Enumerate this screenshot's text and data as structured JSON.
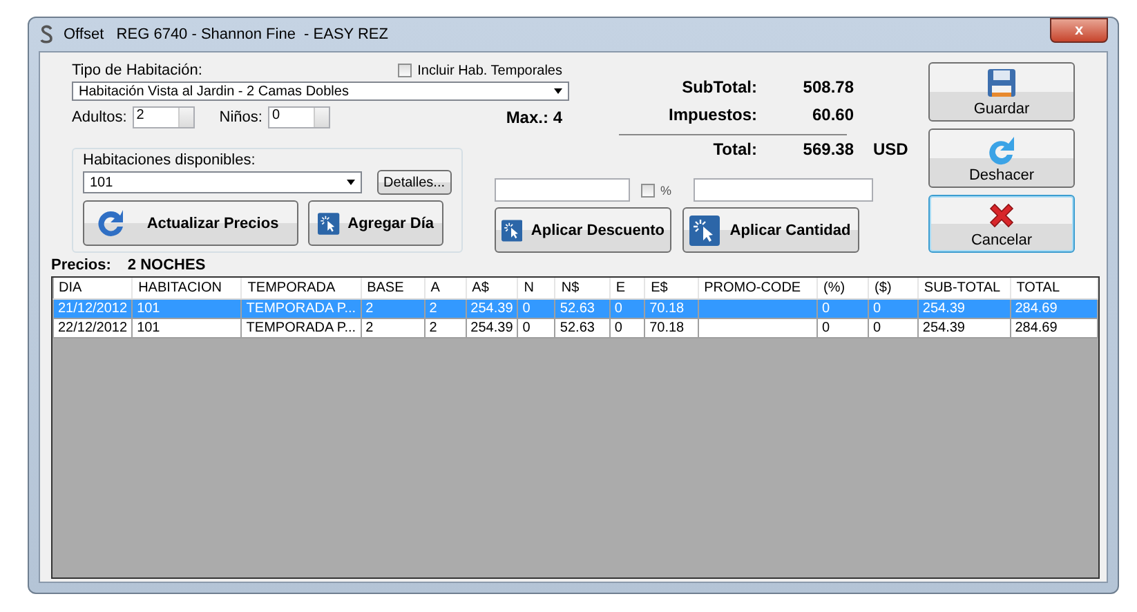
{
  "window": {
    "title": "Offset   REG 6740 - Shannon Fine  - EASY REZ",
    "close_label": "x"
  },
  "room_type": {
    "label": "Tipo de Habitación:",
    "value": "Habitación Vista al Jardin - 2 Camas Dobles"
  },
  "include_temporary": {
    "label": "Incluir Hab. Temporales",
    "checked": false
  },
  "adults": {
    "label": "Adultos:",
    "value": "2"
  },
  "children": {
    "label": "Niños:",
    "value": "0"
  },
  "max": "Max.: 4",
  "available": {
    "label": "Habitaciones disponibles:",
    "value": "101",
    "details_button": "Detalles..."
  },
  "action_buttons": [
    {
      "label": "Actualizar Precios",
      "kind": "refresh"
    },
    {
      "label": "Agregar Día",
      "kind": "click"
    }
  ],
  "discount": {
    "percent_label": "%",
    "percent_checked": false,
    "buttons": [
      {
        "label": "Aplicar Descuento",
        "kind": "click"
      },
      {
        "label": "Aplicar Cantidad",
        "kind": "click"
      }
    ]
  },
  "totals": [
    {
      "label": "SubTotal:",
      "value": "508.78"
    },
    {
      "label": "Impuestos:",
      "value": "60.60"
    },
    {
      "label": "Total:",
      "value": "569.38",
      "currency": "USD"
    }
  ],
  "side_buttons": [
    {
      "label": "Guardar",
      "kind": "save",
      "focused": false
    },
    {
      "label": "Deshacer",
      "kind": "undo",
      "focused": false
    },
    {
      "label": "Cancelar",
      "kind": "cancel",
      "focused": true
    }
  ],
  "prices": {
    "label": "Precios:",
    "nights": "2 NOCHES"
  },
  "table": {
    "columns": [
      "DIA",
      "HABITACION",
      "TEMPORADA",
      "BASE",
      "A",
      "A$",
      "N",
      "N$",
      "E",
      "E$",
      "PROMO-CODE",
      "(%)",
      "($)",
      "SUB-TOTAL",
      "TOTAL"
    ],
    "rows": [
      {
        "selected": true,
        "cells": [
          "21/12/2012",
          "101",
          "TEMPORADA P...",
          "2",
          "2",
          "254.39",
          "0",
          "52.63",
          "0",
          "70.18",
          "",
          "0",
          "0",
          "254.39",
          "284.69"
        ]
      },
      {
        "selected": false,
        "cells": [
          "22/12/2012",
          "101",
          "TEMPORADA P...",
          "2",
          "2",
          "254.39",
          "0",
          "52.63",
          "0",
          "70.18",
          "",
          "0",
          "0",
          "254.39",
          "284.69"
        ]
      }
    ]
  }
}
